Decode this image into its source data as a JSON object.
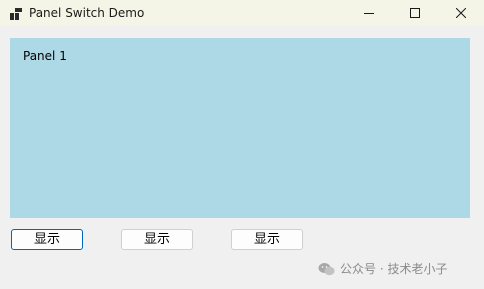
{
  "window": {
    "title": "Panel Switch Demo",
    "icon": "app-icon",
    "controls": [
      "minimize-icon",
      "maximize-icon",
      "close-icon"
    ]
  },
  "panel": {
    "label": "Panel 1",
    "color": "#add8e6"
  },
  "buttons": [
    {
      "label": "显示",
      "focused": true
    },
    {
      "label": "显示",
      "focused": false
    },
    {
      "label": "显示",
      "focused": false
    }
  ],
  "watermark": {
    "text": "公众号 · 技术老小子",
    "icon": "wechat-icon"
  }
}
